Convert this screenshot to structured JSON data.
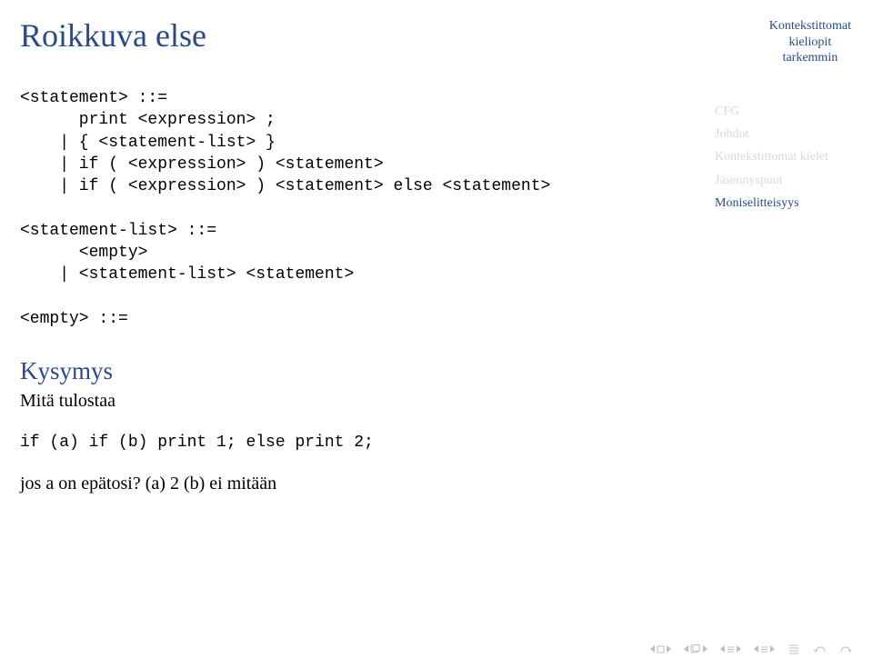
{
  "header": {
    "line1": "Kontekstittomat",
    "line2": "kieliopit",
    "line3": "tarkemmin"
  },
  "title": "Roikkuva else",
  "sidebar": {
    "items": [
      {
        "label": "CFG",
        "active": false
      },
      {
        "label": "Johdot",
        "active": false
      },
      {
        "label": "Kontekstittomat kielet",
        "active": false
      },
      {
        "label": "Jäsennyspuut",
        "active": false
      },
      {
        "label": "Moniselitteisyys",
        "active": true
      }
    ]
  },
  "code": {
    "block1": "<statement> ::=\n      print <expression> ;\n    | { <statement-list> }\n    | if ( <expression> ) <statement>\n    | if ( <expression> ) <statement> else <statement>\n\n<statement-list> ::=\n      <empty>\n    | <statement-list> <statement>\n\n<empty> ::="
  },
  "question": {
    "heading": "Kysymys",
    "sub": "Mitä tulostaa",
    "codeline": "if (a) if (b) print 1; else print 2;",
    "answer": "jos a on epätosi? (a) 2 (b) ei mitään"
  },
  "nav": {
    "btn1": "prev-section",
    "btn2": "prev-slide",
    "btn3": "prev-frame",
    "btn4": "next-frame",
    "btn5": "summary",
    "btn6": "back",
    "btn7": "forward"
  }
}
